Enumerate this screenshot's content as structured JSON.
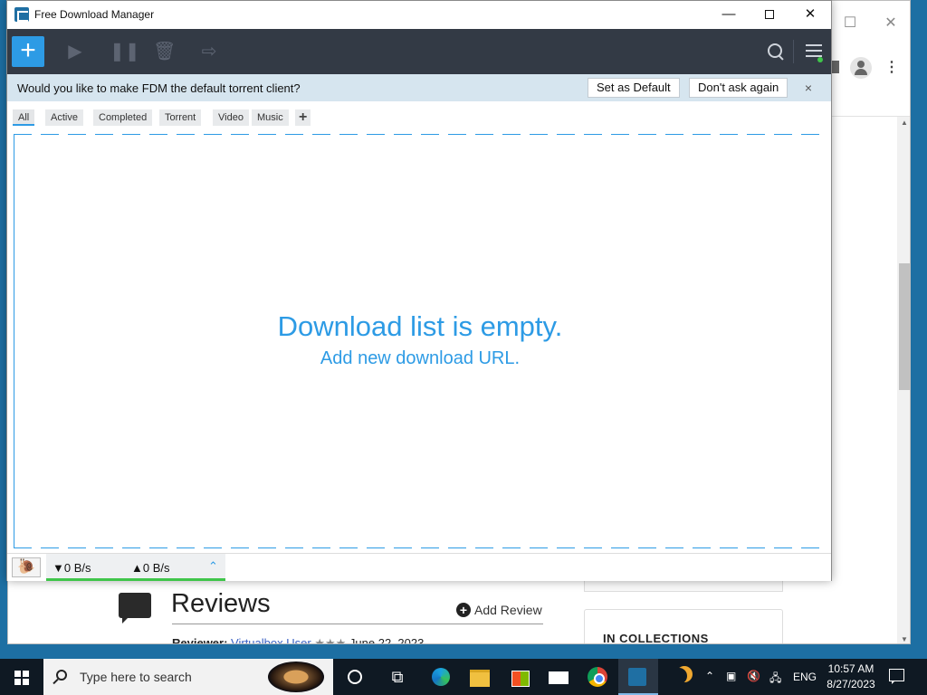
{
  "fdm": {
    "title": "Free Download Manager",
    "toolbar": {
      "add_label": "+"
    },
    "notice": {
      "text": "Would you like to make FDM the default torrent client?",
      "set_default": "Set as Default",
      "dont_ask": "Don't ask again",
      "close": "×"
    },
    "filters": [
      {
        "label": "All",
        "active": true
      },
      {
        "label": "Active",
        "active": false
      },
      {
        "label": "Completed",
        "active": false
      },
      {
        "label": "Torrent",
        "active": false
      },
      {
        "label": "Video",
        "active": false
      },
      {
        "label": "Music",
        "active": false
      }
    ],
    "filter_add": "+",
    "empty": {
      "title": "Download list is empty.",
      "subtitle": "Add new download URL."
    },
    "status": {
      "down_speed": "▼0 B/s",
      "up_speed": "▲0 B/s"
    }
  },
  "browser": {
    "reviews_title": "Reviews",
    "add_review": "Add Review",
    "reviewer_label": "Reviewer:",
    "reviewer_name": "Virtualbox User",
    "reviewer_stars": "★★★",
    "review_date": "June 22, 2023",
    "collections_title": "IN COLLECTIONS"
  },
  "taskbar": {
    "search_placeholder": "Type here to search",
    "lang": "ENG",
    "time": "10:57 AM",
    "date": "8/27/2023"
  },
  "colors": {
    "accent": "#2d9be5",
    "toolbar_bg": "#333a45",
    "notice_bg": "#d6e5ef",
    "speed_ok": "#3fc54a"
  }
}
